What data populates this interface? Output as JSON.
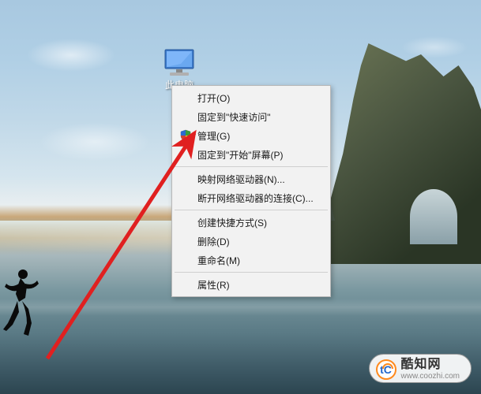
{
  "desktop_icon": {
    "name": "this-pc",
    "label": "此电脑"
  },
  "context_menu": {
    "groups": [
      [
        {
          "id": "open",
          "label": "打开(O)",
          "icon": null
        },
        {
          "id": "pin-quick-access",
          "label": "固定到\"快速访问\"",
          "icon": null
        },
        {
          "id": "manage",
          "label": "管理(G)",
          "icon": "shield"
        },
        {
          "id": "pin-start",
          "label": "固定到\"开始\"屏幕(P)",
          "icon": null
        }
      ],
      [
        {
          "id": "map-drive",
          "label": "映射网络驱动器(N)...",
          "icon": null
        },
        {
          "id": "disconnect-drive",
          "label": "断开网络驱动器的连接(C)...",
          "icon": null
        }
      ],
      [
        {
          "id": "create-shortcut",
          "label": "创建快捷方式(S)",
          "icon": null
        },
        {
          "id": "delete",
          "label": "删除(D)",
          "icon": null
        },
        {
          "id": "rename",
          "label": "重命名(M)",
          "icon": null
        }
      ],
      [
        {
          "id": "properties",
          "label": "属性(R)",
          "icon": null
        }
      ]
    ]
  },
  "watermark": {
    "logo_text": "tC",
    "name_cn": "酷知网",
    "url": "www.coozhi.com"
  },
  "annotation": {
    "type": "arrow",
    "color": "#e02020",
    "target_item": "manage"
  }
}
